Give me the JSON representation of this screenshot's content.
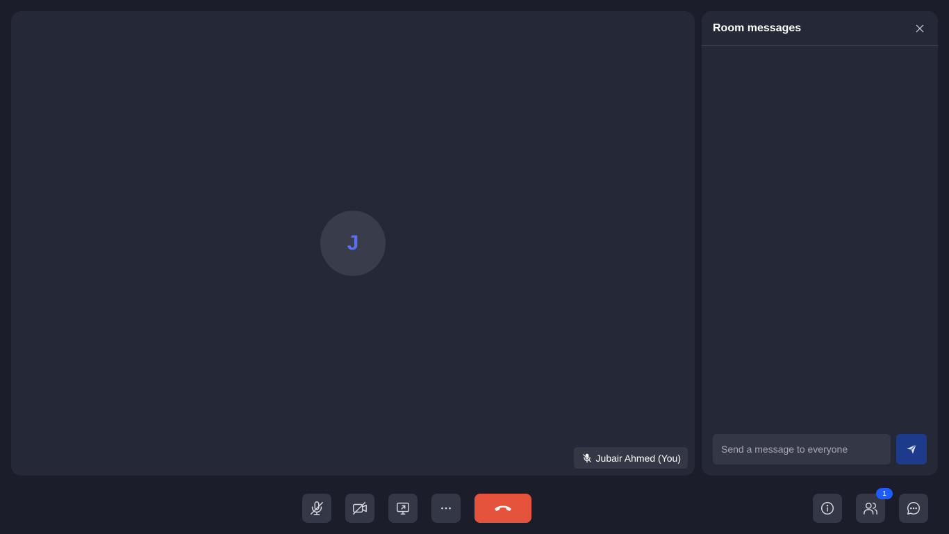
{
  "participant": {
    "initial": "J",
    "name_label": "Jubair Ahmed (You)"
  },
  "chat_panel": {
    "title": "Room messages",
    "input_placeholder": "Send a message to everyone"
  },
  "toolbar": {
    "participants_count": "1"
  },
  "icons": {
    "mic": "mic-off-icon",
    "camera": "camera-off-icon",
    "share": "screen-share-icon",
    "more": "more-icon",
    "end": "hang-up-icon",
    "info": "info-icon",
    "people": "people-icon",
    "chat": "chat-icon",
    "close": "close-icon",
    "send": "send-icon"
  },
  "colors": {
    "background": "#1b1d2a",
    "surface": "#252836",
    "button": "#343745",
    "end_call": "#e5533d",
    "avatar_letter": "#5b6ef0",
    "send_button": "#1e3a8a",
    "badge": "#1f5cff"
  }
}
